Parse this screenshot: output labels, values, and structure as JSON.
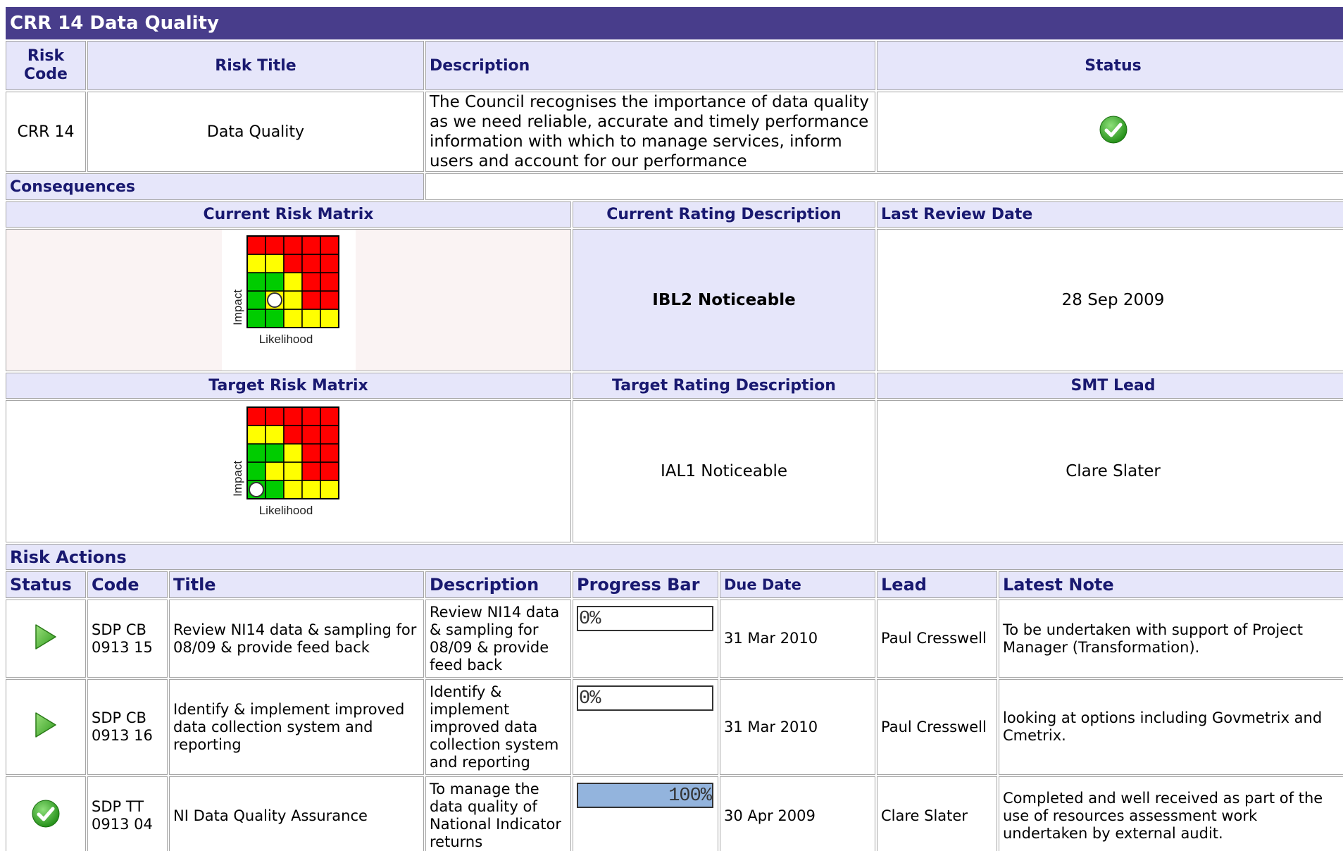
{
  "header": {
    "title": "CRR 14 Data Quality"
  },
  "risk_table": {
    "columns": {
      "code": "Risk Code",
      "title": "Risk Title",
      "description": "Description",
      "status": "Status"
    },
    "row": {
      "code": "CRR 14",
      "title": "Data Quality",
      "description": "The Council recognises the importance of data quality as we need reliable, accurate and timely performance information with which to manage services, inform users and account for our performance",
      "status_icon": "green-check-icon"
    }
  },
  "consequences": {
    "label": "Consequences",
    "value": ""
  },
  "current": {
    "matrix_header": "Current Risk Matrix",
    "rating_header": "Current Rating Description",
    "review_header": "Last Review Date",
    "rating": "IBL2 Noticeable",
    "review_date": "28 Sep 2009",
    "matrix": {
      "x_label": "Likelihood",
      "y_label": "Impact",
      "marker_likelihood": 2,
      "marker_impact": 2
    }
  },
  "target": {
    "matrix_header": "Target Risk Matrix",
    "rating_header": "Target Rating Description",
    "lead_header": "SMT Lead",
    "rating": "IAL1 Noticeable",
    "lead": "Clare Slater",
    "matrix": {
      "x_label": "Likelihood",
      "y_label": "Impact",
      "marker_likelihood": 1,
      "marker_impact": 1
    }
  },
  "matrix_colors": {
    "grid": [
      [
        "G",
        "G",
        "Y",
        "Y",
        "Y"
      ],
      [
        "G",
        "Y",
        "Y",
        "R",
        "R"
      ],
      [
        "G",
        "G",
        "Y",
        "R",
        "R"
      ],
      [
        "Y",
        "Y",
        "R",
        "R",
        "R"
      ],
      [
        "R",
        "R",
        "R",
        "R",
        "R"
      ]
    ],
    "red": "#ff0000",
    "yellow": "#ffff00",
    "green": "#00cc00"
  },
  "actions": {
    "section_label": "Risk Actions",
    "columns": {
      "status": "Status",
      "code": "Code",
      "title": "Title",
      "description": "Description",
      "progress": "Progress Bar",
      "due": "Due Date",
      "lead": "Lead",
      "note": "Latest Note"
    },
    "rows": [
      {
        "status_icon": "green-play-icon",
        "code": "SDP CB 0913 15",
        "title": "Review NI14 data & sampling for 08/09 & provide feed back",
        "description": "Review NI14 data & sampling for 08/09 & provide feed back",
        "progress": 0,
        "progress_label": "0%",
        "due": "31 Mar 2010",
        "lead": "Paul Cresswell",
        "note": "To be undertaken with support of Project Manager (Transformation)."
      },
      {
        "status_icon": "green-play-icon",
        "code": "SDP CB 0913 16",
        "title": "Identify & implement improved data collection system and reporting",
        "description": "Identify & implement improved data collection system and reporting",
        "progress": 0,
        "progress_label": "0%",
        "due": "31 Mar 2010",
        "lead": "Paul Cresswell",
        "note": "looking at options including Govmetrix and Cmetrix."
      },
      {
        "status_icon": "green-check-icon",
        "code": "SDP TT 0913 04",
        "title": "NI Data Quality Assurance",
        "description": "To manage the data quality of National Indicator returns",
        "progress": 100,
        "progress_label": "100%",
        "due": "30 Apr 2009",
        "lead": "Clare Slater",
        "note": "Completed and well received as part of the use of resources assessment work undertaken by external audit."
      }
    ]
  },
  "colors": {
    "title_bar": "#483d8b",
    "header_bg": "#e6e6fa",
    "header_text": "#191970",
    "progress_fill": "#93b4dd"
  }
}
